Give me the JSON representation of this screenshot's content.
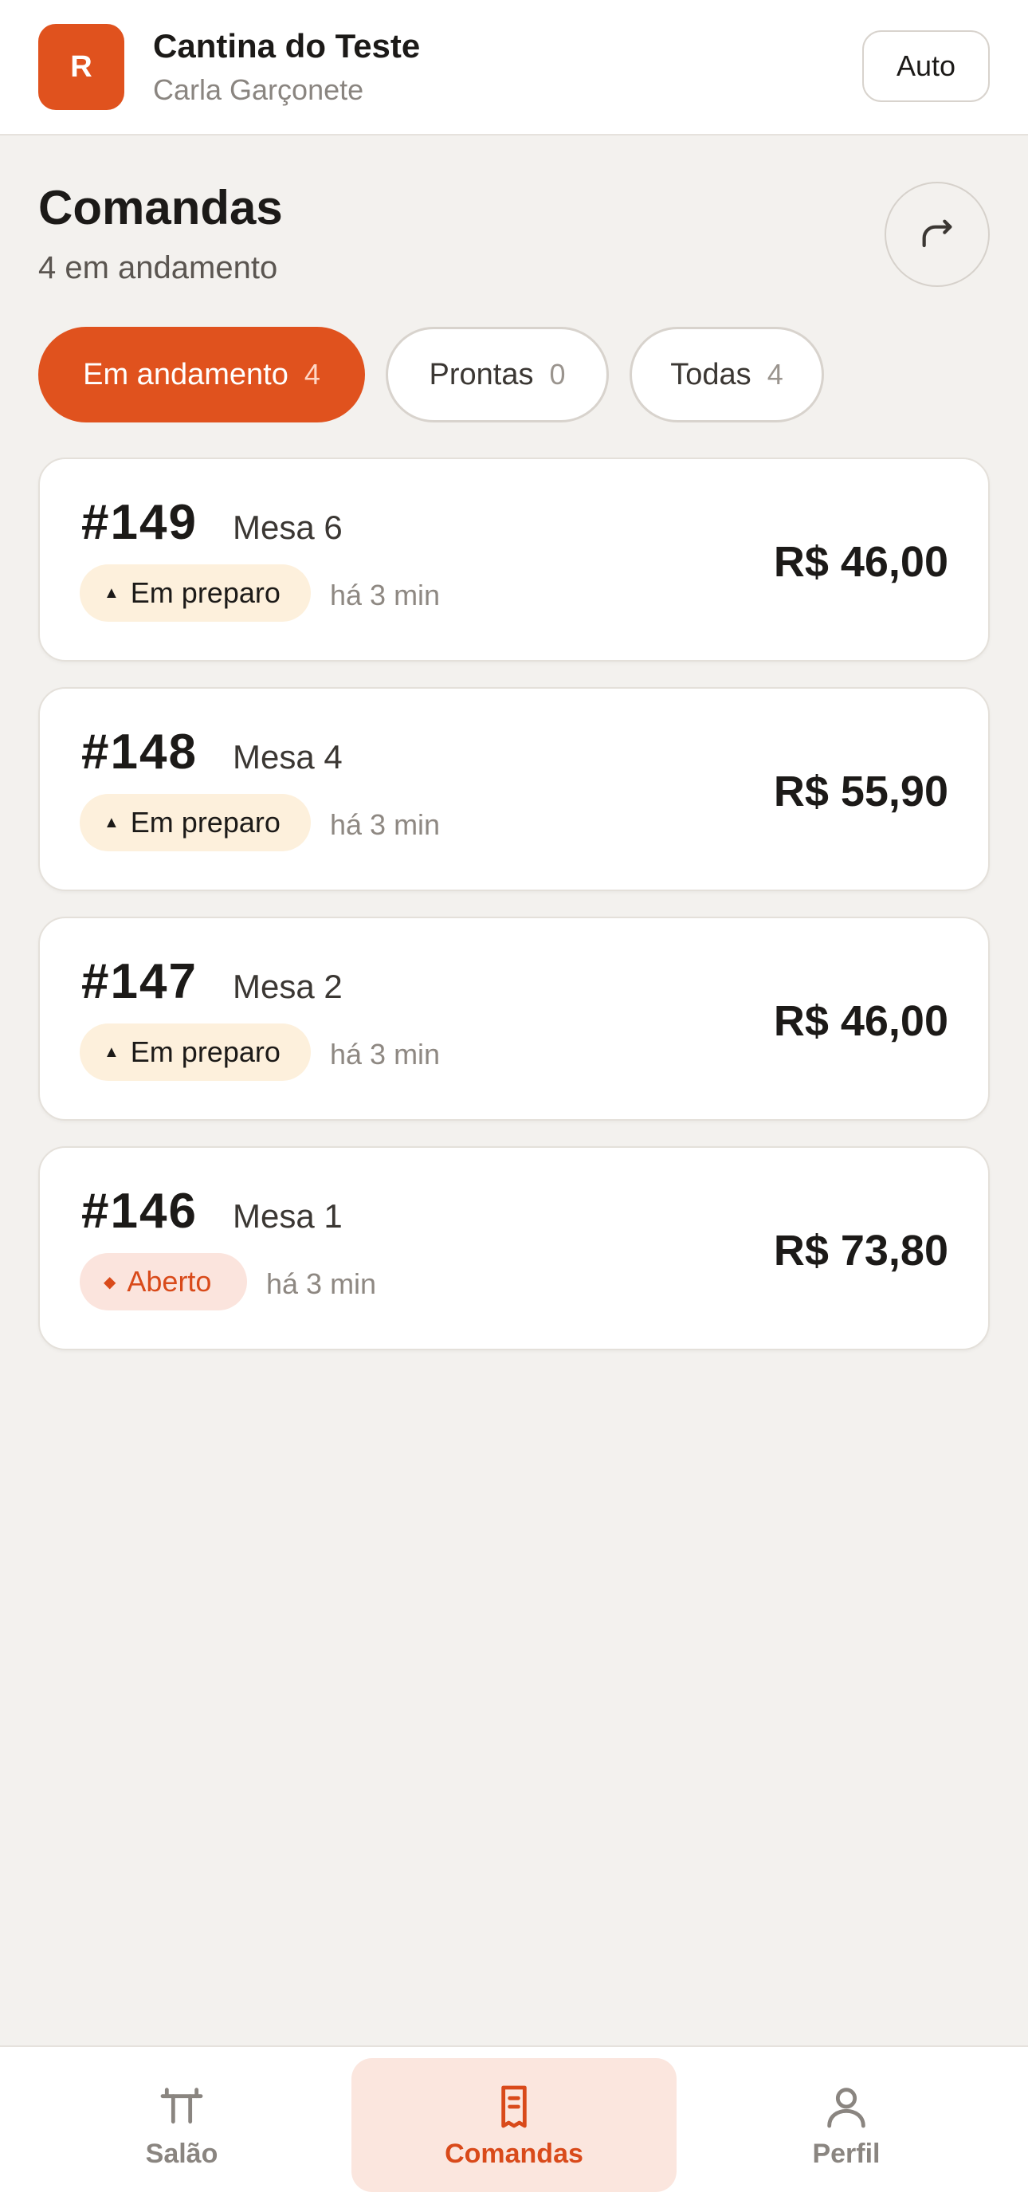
{
  "header": {
    "avatar_letter": "R",
    "restaurant_name": "Cantina do Teste",
    "user_name": "Carla Garçonete",
    "auto_label": "Auto"
  },
  "page": {
    "title": "Comandas",
    "subtitle": "4 em andamento",
    "refresh_icon": "refresh-icon"
  },
  "tabs": [
    {
      "label": "Em andamento",
      "count": "4",
      "active": true
    },
    {
      "label": "Prontas",
      "count": "0",
      "active": false
    },
    {
      "label": "Todas",
      "count": "4",
      "active": false
    }
  ],
  "orders": [
    {
      "number": "#149",
      "table": "Mesa 6",
      "status": "Em preparo",
      "status_glyph": "▲",
      "time": "há 3 min",
      "amount": "R$ 46,00"
    },
    {
      "number": "#148",
      "table": "Mesa 4",
      "status": "Em preparo",
      "status_glyph": "▲",
      "time": "há 3 min",
      "amount": "R$ 55,90"
    },
    {
      "number": "#147",
      "table": "Mesa 2",
      "status": "Em preparo",
      "status_glyph": "▲",
      "time": "há 3 min",
      "amount": "R$ 46,00"
    },
    {
      "number": "#146",
      "table": "Mesa 1",
      "status": "Aberto",
      "status_glyph": "◆",
      "time": "há 3 min",
      "amount": "R$ 73,80"
    }
  ],
  "nav": [
    {
      "label": "Salão",
      "icon": "table-icon",
      "active": false
    },
    {
      "label": "Comandas",
      "icon": "receipt-icon",
      "active": true
    },
    {
      "label": "Perfil",
      "icon": "user-icon",
      "active": false
    }
  ],
  "colors": {
    "accent": "#e0521e",
    "background": "#f3f1ee",
    "card": "#ffffff",
    "badge_prep": "#fdf0dc",
    "badge_open": "#fbe4dd"
  }
}
